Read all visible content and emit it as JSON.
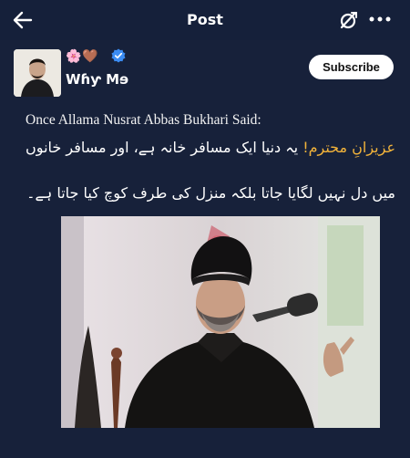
{
  "header": {
    "title": "Post",
    "back_icon": "arrow-left-icon",
    "nostr_icon": "nostr-slash-icon",
    "more_icon": "more-dots-icon"
  },
  "author": {
    "name": "Wɦƴ Mɘ",
    "emojis": "🌸🤎",
    "verified_icon": "verified-badge-icon",
    "subscribe_label": "Subscribe"
  },
  "post": {
    "text_en": "Once Allama Nusrat Abbas Bukhari Said:",
    "urdu_line1_highlight": "عزیزانِ محترم!",
    "urdu_line1_rest": " یہ دنیا ایک مسافر خانہ ہے، اور مسافر خانوں",
    "urdu_line2": "میں دل نہیں لگایا جاتا بلکہ منزل کی طرف کوچ کیا جاتا ہے۔"
  },
  "colors": {
    "background": "#17213a",
    "highlight": "#f2b33a",
    "verified": "#3b8cf3"
  }
}
